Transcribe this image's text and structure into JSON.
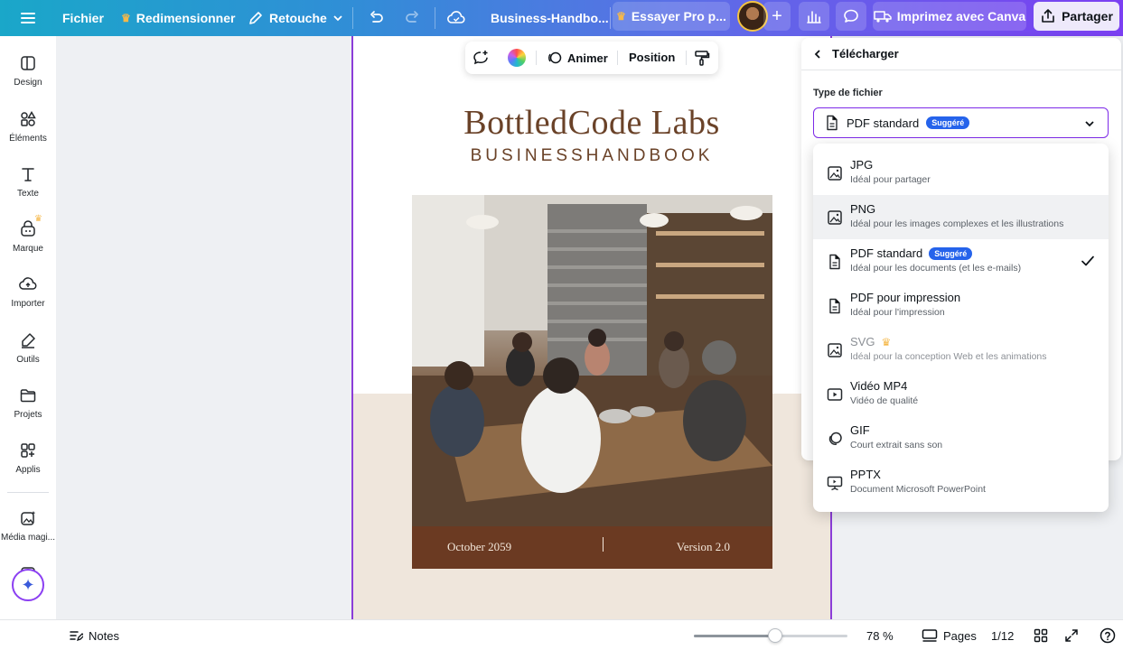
{
  "topbar": {
    "file_label": "Fichier",
    "resize_label": "Redimensionner",
    "edit_label": "Retouche",
    "doc_title": "Business-Handbo...",
    "try_pro_label": "Essayer Pro p...",
    "print_label": "Imprimez avec Canva",
    "share_label": "Partager"
  },
  "sidebar": {
    "items": [
      {
        "label": "Design",
        "icon": "design-icon"
      },
      {
        "label": "Éléments",
        "icon": "elements-icon"
      },
      {
        "label": "Texte",
        "icon": "text-icon"
      },
      {
        "label": "Marque",
        "icon": "brand-icon"
      },
      {
        "label": "Importer",
        "icon": "upload-icon"
      },
      {
        "label": "Outils",
        "icon": "tools-icon"
      },
      {
        "label": "Projets",
        "icon": "folder-icon"
      },
      {
        "label": "Applis",
        "icon": "apps-icon"
      },
      {
        "label": "Média magi...",
        "icon": "magic-media-icon"
      }
    ]
  },
  "floating_toolbar": {
    "animate_label": "Animer",
    "position_label": "Position"
  },
  "canvas": {
    "brand_title": "BottledCode Labs",
    "brand_subtitle": "BUSINESSHANDBOOK",
    "footer_left": "October 2059",
    "footer_right": "Version 2.0"
  },
  "download_panel": {
    "title": "Télécharger",
    "file_type_label": "Type de fichier",
    "selected_value": "PDF standard",
    "selected_badge": "Suggéré",
    "options": [
      {
        "name": "JPG",
        "desc": "Idéal pour partager",
        "icon": "image-icon"
      },
      {
        "name": "PNG",
        "desc": "Idéal pour les images complexes et les illustrations",
        "icon": "image-icon"
      },
      {
        "name": "PDF standard",
        "desc": "Idéal pour les documents (et les e-mails)",
        "icon": "document-icon",
        "badge": "Suggéré"
      },
      {
        "name": "PDF pour impression",
        "desc": "Idéal pour l'impression",
        "icon": "document-icon"
      },
      {
        "name": "SVG",
        "desc": "Idéal pour la conception Web et les animations",
        "icon": "image-icon"
      },
      {
        "name": "Vidéo MP4",
        "desc": "Vidéo de qualité",
        "icon": "video-icon"
      },
      {
        "name": "GIF",
        "desc": "Court extrait sans son",
        "icon": "gif-icon"
      },
      {
        "name": "PPTX",
        "desc": "Document Microsoft PowerPoint",
        "icon": "presentation-icon"
      }
    ]
  },
  "bottombar": {
    "notes_label": "Notes",
    "zoom_value": "78 %",
    "zoom_fraction": 0.53,
    "pages_label": "Pages",
    "page_indicator": "1/12"
  },
  "colors": {
    "accent_purple": "#7d2ae8",
    "badge_blue": "#2563eb",
    "brand_brown": "#6a4228",
    "crown_gold": "#f5b84a"
  }
}
